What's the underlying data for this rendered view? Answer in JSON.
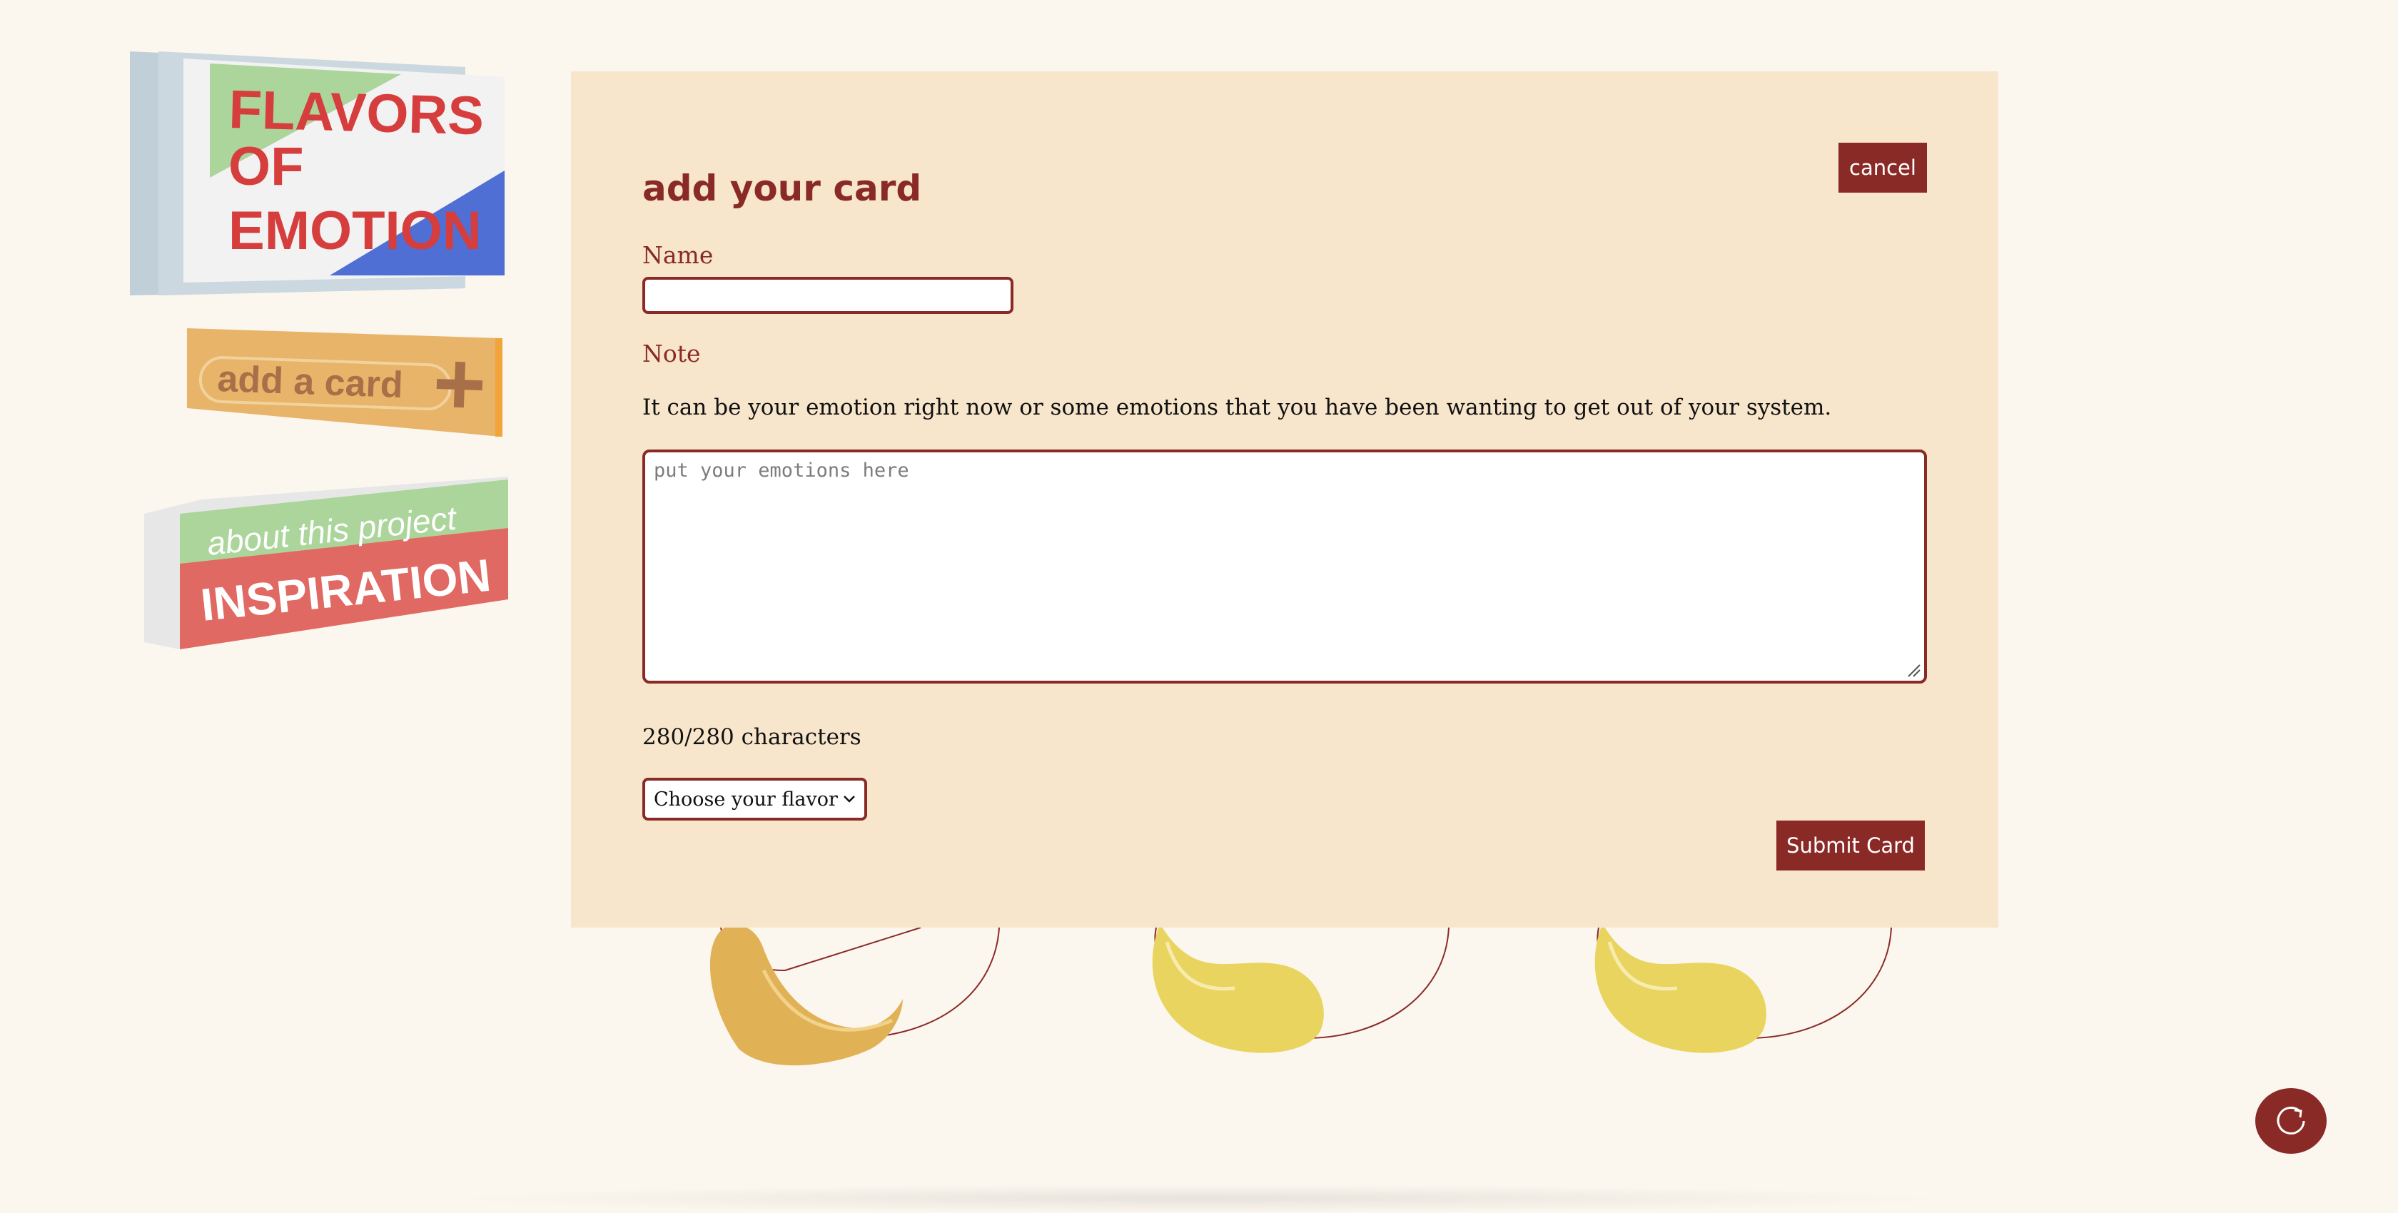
{
  "sidebar": {
    "logo_lines": [
      "FLAVORS",
      "OF",
      "EMOTION"
    ],
    "add_card_label": "add a card",
    "about_top": "about this project",
    "about_bottom": "INSPIRATION"
  },
  "modal": {
    "title": "add your card",
    "cancel_label": "cancel",
    "name_label": "Name",
    "name_value": "",
    "note_label": "Note",
    "note_hint": "It can be your emotion right now or some emotions that you have been wanting to get out of your system.",
    "note_placeholder": "put your emotions here",
    "note_value": "",
    "char_count": "280/280 characters",
    "flavor_selected": "Choose your flavor",
    "submit_label": "Submit Card"
  },
  "colors": {
    "accent": "#8a2a26",
    "modal_bg": "#f7e6cb",
    "page_bg": "#fbf7ef"
  },
  "icons": {
    "refresh": "refresh-icon",
    "select_arrow": "chevron-down-icon",
    "add_card_plus": "plus-icon"
  }
}
